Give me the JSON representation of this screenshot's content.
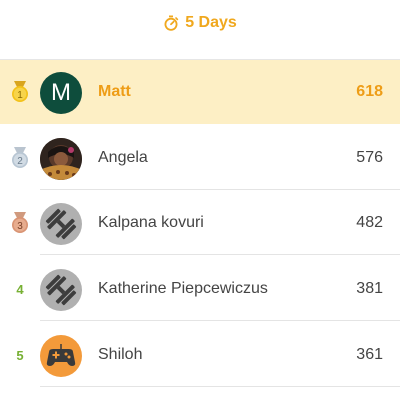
{
  "header": {
    "title": "5 Days",
    "timer_icon": "timer-icon",
    "accent_color": "#f0a81e"
  },
  "leaderboard": [
    {
      "rank": "1",
      "name": "Matt",
      "score": "618",
      "avatar_letter": "M",
      "avatar_color": "#0e4d3c",
      "highlighted": true,
      "rank_icon": "gold-medal-icon"
    },
    {
      "rank": "2",
      "name": "Angela",
      "score": "576",
      "avatar_type": "photo",
      "rank_icon": "silver-medal-icon"
    },
    {
      "rank": "3",
      "name": "Kalpana kovuri",
      "score": "482",
      "avatar_type": "dumbbell-icon",
      "rank_icon": "bronze-medal-icon"
    },
    {
      "rank": "4",
      "name": "Katherine Piepcewiczus",
      "score": "381",
      "avatar_type": "dumbbell-icon"
    },
    {
      "rank": "5",
      "name": "Shiloh",
      "score": "361",
      "avatar_type": "gamepad-icon",
      "avatar_color": "#f39a3a"
    }
  ]
}
